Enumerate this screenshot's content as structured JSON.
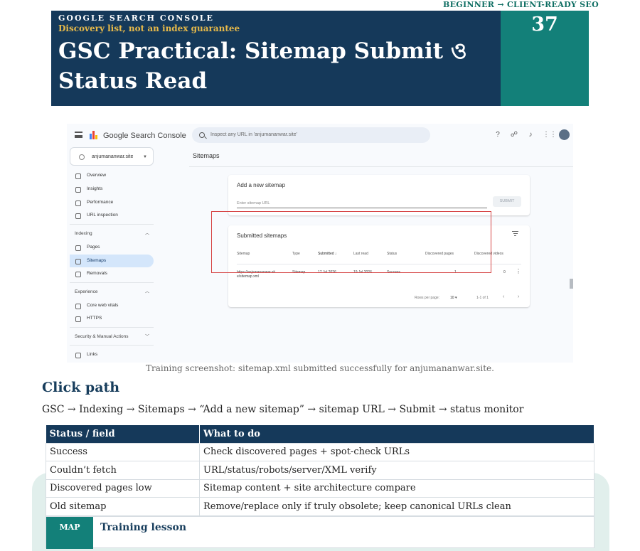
{
  "header": {
    "top_tag": "BEGINNER → CLIENT-READY SEO",
    "kicker": "GOOGLE SEARCH CONSOLE",
    "subtitle": "Discovery list, not an index guarantee",
    "title": "GSC Practical: Sitemap Submit ও Status Read",
    "number": "37"
  },
  "screenshot": {
    "brand": "Google Search Console",
    "search_placeholder": "Inspect any URL in 'anjumananwar.site'",
    "property": "anjumananwar.site",
    "page_title": "Sitemaps",
    "nav": [
      {
        "label": "Overview",
        "icon": "home-icon"
      },
      {
        "label": "Insights",
        "icon": "insights-icon"
      },
      {
        "label": "Performance",
        "icon": "trend-icon"
      },
      {
        "label": "URL inspection",
        "icon": "search-icon"
      }
    ],
    "section_indexing": "Indexing",
    "nav_indexing": [
      {
        "label": "Pages",
        "icon": "pages-icon"
      },
      {
        "label": "Sitemaps",
        "icon": "sitemap-icon",
        "active": true
      },
      {
        "label": "Removals",
        "icon": "removals-icon"
      }
    ],
    "section_experience": "Experience",
    "nav_experience": [
      {
        "label": "Core web vitals",
        "icon": "gauge-icon"
      },
      {
        "label": "HTTPS",
        "icon": "lock-icon"
      }
    ],
    "section_security": "Security & Manual Actions",
    "nav_links": "Links",
    "add_card_title": "Add a new sitemap",
    "input_placeholder": "Enter sitemap URL",
    "submit_label": "SUBMIT",
    "submitted_title": "Submitted sitemaps",
    "columns": [
      "Sitemap",
      "Type",
      "Submitted",
      "Last read",
      "Status",
      "Discovered pages",
      "Discovered videos"
    ],
    "row": {
      "sitemap_line1": "https://anjumananwar.sit",
      "sitemap_line2": "e/sitemap.xml",
      "type": "Sitemap",
      "submitted": "17 Jul 2026",
      "last_read": "19 Jul 2026",
      "status": "Success",
      "discovered_pages": "1",
      "discovered_videos": "0"
    },
    "rows_per_page_label": "Rows per page:",
    "rows_per_page": "10",
    "range": "1-1 of 1"
  },
  "caption": "Training screenshot: sitemap.xml submitted successfully for anjumananwar.site.",
  "click_path": {
    "heading": "Click path",
    "text": "GSC → Indexing → Sitemaps → “Add a new sitemap” → sitemap URL → Submit → status monitor"
  },
  "table": {
    "headers": [
      "Status / field",
      "What to do"
    ],
    "rows": [
      [
        "Success",
        "Check discovered pages + spot-check URLs"
      ],
      [
        "Couldn’t fetch",
        "URL/status/robots/server/XML verify"
      ],
      [
        "Discovered pages low",
        "Sitemap content + site architecture compare"
      ],
      [
        "Old sitemap",
        "Remove/replace only if truly obsolete; keep canonical URLs clean"
      ]
    ]
  },
  "lesson": {
    "tag": "MAP",
    "title": "Training lesson"
  },
  "colors": {
    "navy": "#15395a",
    "teal": "#138079",
    "gold": "#e6b94a",
    "highlight_red": "#d64545"
  }
}
